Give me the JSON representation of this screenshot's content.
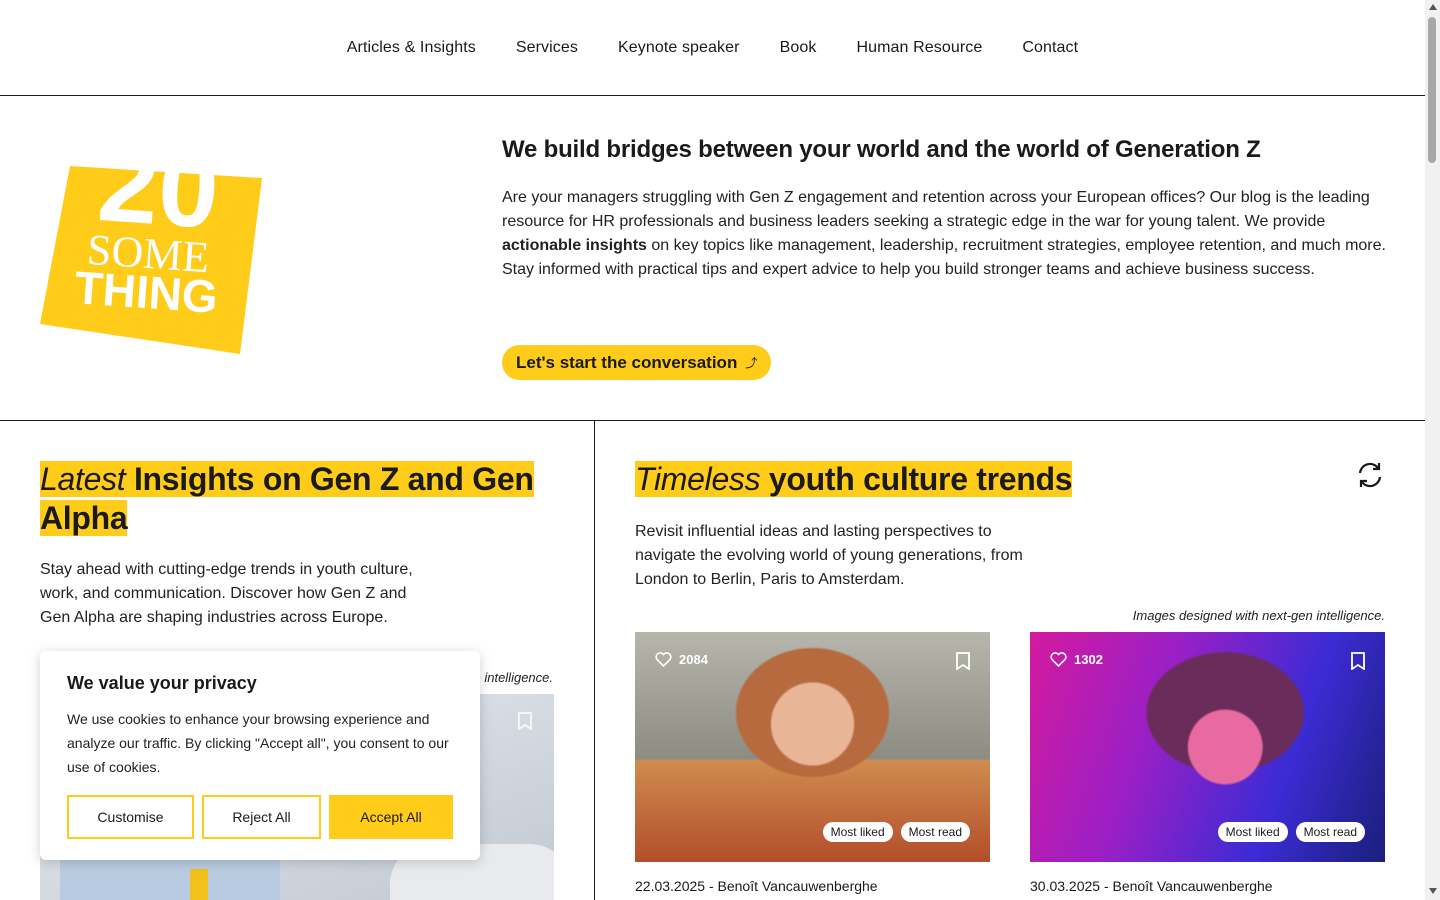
{
  "nav": {
    "items": [
      "Articles & Insights",
      "Services",
      "Keynote speaker",
      "Book",
      "Human Resource",
      "Contact"
    ]
  },
  "logo": {
    "top": "20",
    "mid": "SOME",
    "bottom": "THING",
    "color": "#ffcc1a"
  },
  "hero": {
    "title": "We build bridges between your world and the world of Generation Z",
    "text_before": "Are your managers struggling with Gen Z engagement and retention across your European offices?  Our blog is the leading resource for HR professionals and business leaders seeking a strategic edge in the war for young talent. We provide ",
    "text_bold": "actionable insights",
    "text_after": " on key topics like management, leadership, recruitment strategies, employee retention, and much more. Stay informed with practical tips and expert advice to help you build stronger teams and achieve business success.",
    "cta_label": "Let's start the conversation",
    "cta_arrow": "⤴"
  },
  "latest": {
    "title_italic": "Latest",
    "title_rest": " Insights on Gen Z and Gen Alpha",
    "subtitle": "Stay ahead with cutting-edge trends in youth culture, work, and communication. Discover how Gen Z and Gen Alpha are shaping industries across Europe.",
    "caption": "Images designed with next-gen intelligence."
  },
  "timeless": {
    "title_italic": "Timeless",
    "title_rest": " youth culture trends",
    "subtitle": "Revisit influential ideas and lasting perspectives to navigate the evolving world of young generations, from London to Berlin, Paris to Amsterdam.",
    "caption": "Images designed with next-gen intelligence.",
    "cards": [
      {
        "likes": "2084",
        "tags": [
          "Most liked",
          "Most read"
        ],
        "meta": "22.03.2025 - Benoît Vancauwenberghe"
      },
      {
        "likes": "1302",
        "tags": [
          "Most liked",
          "Most read"
        ],
        "meta": "30.03.2025 - Benoît Vancauwenberghe"
      }
    ]
  },
  "cookie": {
    "title": "We value your privacy",
    "text": "We use cookies to enhance your browsing experience and analyze our traffic. By clicking \"Accept all\", you consent to our use of cookies.",
    "customise": "Customise",
    "reject": "Reject All",
    "accept": "Accept All"
  },
  "colors": {
    "accent": "#ffcc1a",
    "text": "#1a1a1a"
  }
}
